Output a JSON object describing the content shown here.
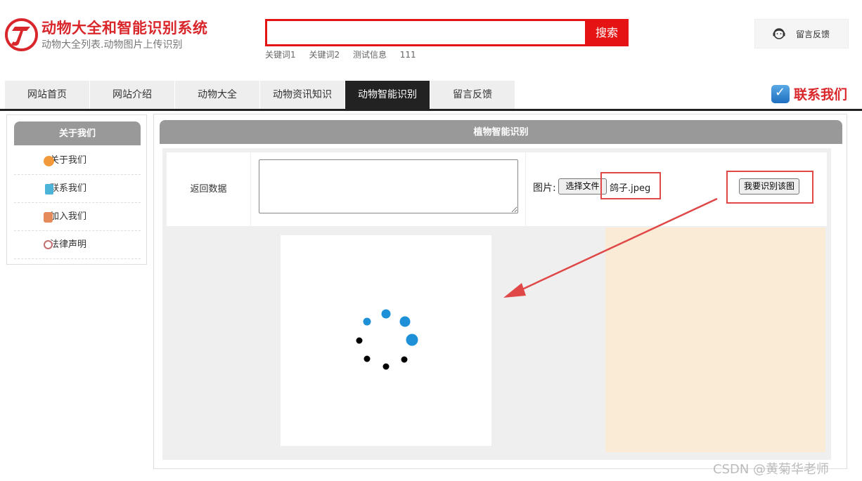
{
  "header": {
    "title": "动物大全和智能识别系统",
    "subtitle": "动物大全列表.动物图片上传识别",
    "search": {
      "placeholder": "",
      "button_label": "搜索"
    },
    "keywords": [
      "关键词1",
      "关键词2",
      "测试信息",
      "111"
    ],
    "feedback_label": "留言反馈"
  },
  "nav": {
    "items": [
      "网站首页",
      "网站介绍",
      "动物大全",
      "动物资讯知识",
      "动物智能识别",
      "留言反馈"
    ],
    "active_index": 4,
    "contact_label": "联系我们"
  },
  "sidebar": {
    "title": "关于我们",
    "items": [
      {
        "label": "关于我们",
        "icon": "orange-circle-icon",
        "color": "#f29a3b"
      },
      {
        "label": "联系我们",
        "icon": "clipboard-icon",
        "color": "#4cb3d9"
      },
      {
        "label": "加入我们",
        "icon": "lock-icon",
        "color": "#e58a5b"
      },
      {
        "label": "法律声明",
        "icon": "power-icon",
        "color": "#c07070"
      }
    ]
  },
  "main": {
    "title": "植物智能识别",
    "return_label": "返回数据",
    "return_value": "",
    "image_label": "图片:",
    "file_button_label": "选择文件",
    "file_name": "鸽子.jpeg",
    "recognize_button_label": "我要识别该图"
  },
  "colors": {
    "brand_red": "#d9262b",
    "search_red": "#e51313",
    "nav_active": "#222222",
    "highlight_red": "#e04848",
    "spinner_blue": "#1e90d8",
    "result_panel": "#faebd7"
  },
  "watermark": "CSDN @黄菊华老师"
}
